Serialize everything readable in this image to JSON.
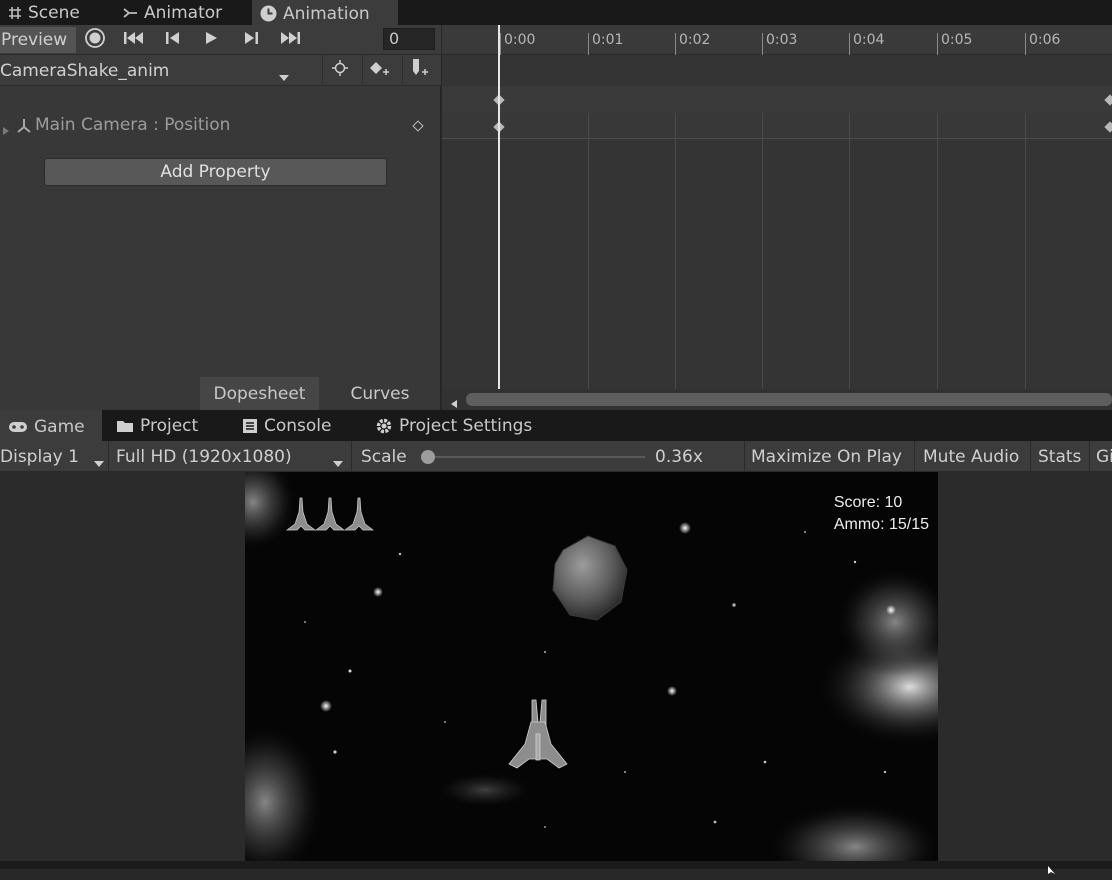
{
  "top_tabs": {
    "scene": "Scene",
    "animator": "Animator",
    "animation": "Animation"
  },
  "animation": {
    "preview_label": "Preview",
    "frame_value": "0",
    "clip_name": "CameraShake_anim",
    "property_label": "Main Camera : Position",
    "add_property_label": "Add Property",
    "view_tabs": {
      "dopesheet": "Dopesheet",
      "curves": "Curves"
    },
    "timeline_ticks": [
      "0:00",
      "0:01",
      "0:02",
      "0:03",
      "0:04",
      "0:05",
      "0:06"
    ]
  },
  "game_tabs": {
    "game": "Game",
    "project": "Project",
    "console": "Console",
    "project_settings": "Project Settings"
  },
  "game_toolbar": {
    "display": "Display 1",
    "resolution": "Full HD (1920x1080)",
    "scale_label": "Scale",
    "scale_value": "0.36x",
    "maximize": "Maximize On Play",
    "mute": "Mute Audio",
    "stats": "Stats",
    "gizmos": "Gi"
  },
  "hud": {
    "score": "Score: 10",
    "ammo": "Ammo: 15/15",
    "lives": 3
  },
  "colors": {
    "panel_bg": "#383838",
    "tab_bar_bg": "#191919",
    "active_tab_bg": "#3c3c3c",
    "playhead": "#e6e6e6",
    "game_bg": "#050505"
  }
}
